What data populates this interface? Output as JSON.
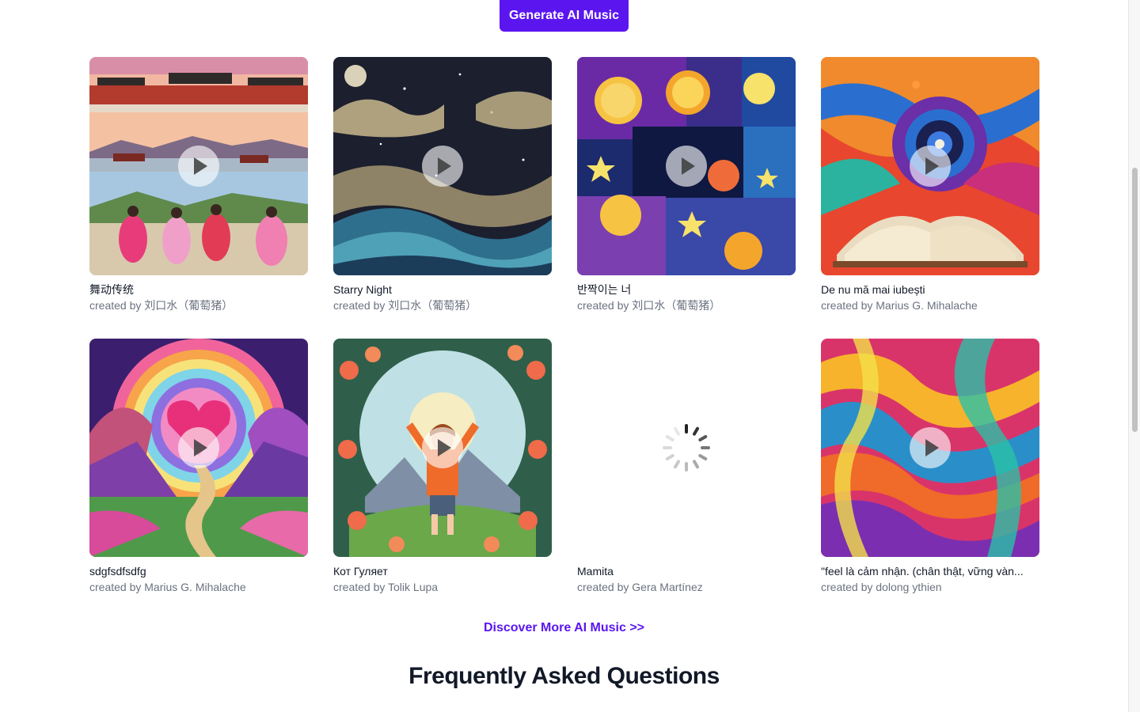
{
  "header": {
    "generate_label": "Generate AI Music"
  },
  "cards": [
    {
      "title": "舞动传统",
      "author": "created by 刘口水（葡萄猪）",
      "state": "play",
      "icon": "play-icon"
    },
    {
      "title": "Starry Night",
      "author": "created by 刘口水（葡萄猪）",
      "state": "play",
      "icon": "play-icon"
    },
    {
      "title": "반짝이는 너",
      "author": "created by 刘口水（葡萄猪）",
      "state": "play",
      "icon": "play-icon"
    },
    {
      "title": "De nu mă mai iubești",
      "author": "created by Marius G. Mihalache",
      "state": "play",
      "icon": "play-icon"
    },
    {
      "title": "sdgfsdfsdfg",
      "author": "created by Marius G. Mihalache",
      "state": "play",
      "icon": "play-icon"
    },
    {
      "title": "Кот Гуляет",
      "author": "created by Tolik Lupa",
      "state": "play",
      "icon": "play-icon"
    },
    {
      "title": "Mamita",
      "author": "created by Gera Martínez",
      "state": "loading",
      "icon": "loading-spinner-icon"
    },
    {
      "title": "\"feel là cảm nhận. (chân thật, vững vàn...",
      "author": "created by dolong ythien",
      "state": "play",
      "icon": "play-icon"
    }
  ],
  "discover_label": "Discover More AI Music >>",
  "faq": {
    "title": "Frequently Asked Questions"
  },
  "colors": {
    "accent": "#5b16f0",
    "text": "#111827",
    "muted": "#6b7280"
  }
}
